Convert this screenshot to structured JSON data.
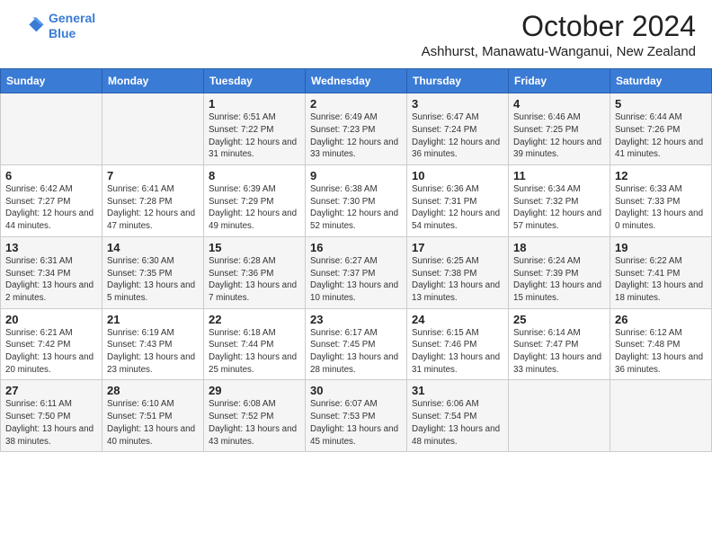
{
  "header": {
    "logo_line1": "General",
    "logo_line2": "Blue",
    "title": "October 2024",
    "subtitle": "Ashhurst, Manawatu-Wanganui, New Zealand"
  },
  "weekdays": [
    "Sunday",
    "Monday",
    "Tuesday",
    "Wednesday",
    "Thursday",
    "Friday",
    "Saturday"
  ],
  "weeks": [
    [
      {
        "day": "",
        "info": ""
      },
      {
        "day": "",
        "info": ""
      },
      {
        "day": "1",
        "info": "Sunrise: 6:51 AM\nSunset: 7:22 PM\nDaylight: 12 hours and 31 minutes."
      },
      {
        "day": "2",
        "info": "Sunrise: 6:49 AM\nSunset: 7:23 PM\nDaylight: 12 hours and 33 minutes."
      },
      {
        "day": "3",
        "info": "Sunrise: 6:47 AM\nSunset: 7:24 PM\nDaylight: 12 hours and 36 minutes."
      },
      {
        "day": "4",
        "info": "Sunrise: 6:46 AM\nSunset: 7:25 PM\nDaylight: 12 hours and 39 minutes."
      },
      {
        "day": "5",
        "info": "Sunrise: 6:44 AM\nSunset: 7:26 PM\nDaylight: 12 hours and 41 minutes."
      }
    ],
    [
      {
        "day": "6",
        "info": "Sunrise: 6:42 AM\nSunset: 7:27 PM\nDaylight: 12 hours and 44 minutes."
      },
      {
        "day": "7",
        "info": "Sunrise: 6:41 AM\nSunset: 7:28 PM\nDaylight: 12 hours and 47 minutes."
      },
      {
        "day": "8",
        "info": "Sunrise: 6:39 AM\nSunset: 7:29 PM\nDaylight: 12 hours and 49 minutes."
      },
      {
        "day": "9",
        "info": "Sunrise: 6:38 AM\nSunset: 7:30 PM\nDaylight: 12 hours and 52 minutes."
      },
      {
        "day": "10",
        "info": "Sunrise: 6:36 AM\nSunset: 7:31 PM\nDaylight: 12 hours and 54 minutes."
      },
      {
        "day": "11",
        "info": "Sunrise: 6:34 AM\nSunset: 7:32 PM\nDaylight: 12 hours and 57 minutes."
      },
      {
        "day": "12",
        "info": "Sunrise: 6:33 AM\nSunset: 7:33 PM\nDaylight: 13 hours and 0 minutes."
      }
    ],
    [
      {
        "day": "13",
        "info": "Sunrise: 6:31 AM\nSunset: 7:34 PM\nDaylight: 13 hours and 2 minutes."
      },
      {
        "day": "14",
        "info": "Sunrise: 6:30 AM\nSunset: 7:35 PM\nDaylight: 13 hours and 5 minutes."
      },
      {
        "day": "15",
        "info": "Sunrise: 6:28 AM\nSunset: 7:36 PM\nDaylight: 13 hours and 7 minutes."
      },
      {
        "day": "16",
        "info": "Sunrise: 6:27 AM\nSunset: 7:37 PM\nDaylight: 13 hours and 10 minutes."
      },
      {
        "day": "17",
        "info": "Sunrise: 6:25 AM\nSunset: 7:38 PM\nDaylight: 13 hours and 13 minutes."
      },
      {
        "day": "18",
        "info": "Sunrise: 6:24 AM\nSunset: 7:39 PM\nDaylight: 13 hours and 15 minutes."
      },
      {
        "day": "19",
        "info": "Sunrise: 6:22 AM\nSunset: 7:41 PM\nDaylight: 13 hours and 18 minutes."
      }
    ],
    [
      {
        "day": "20",
        "info": "Sunrise: 6:21 AM\nSunset: 7:42 PM\nDaylight: 13 hours and 20 minutes."
      },
      {
        "day": "21",
        "info": "Sunrise: 6:19 AM\nSunset: 7:43 PM\nDaylight: 13 hours and 23 minutes."
      },
      {
        "day": "22",
        "info": "Sunrise: 6:18 AM\nSunset: 7:44 PM\nDaylight: 13 hours and 25 minutes."
      },
      {
        "day": "23",
        "info": "Sunrise: 6:17 AM\nSunset: 7:45 PM\nDaylight: 13 hours and 28 minutes."
      },
      {
        "day": "24",
        "info": "Sunrise: 6:15 AM\nSunset: 7:46 PM\nDaylight: 13 hours and 31 minutes."
      },
      {
        "day": "25",
        "info": "Sunrise: 6:14 AM\nSunset: 7:47 PM\nDaylight: 13 hours and 33 minutes."
      },
      {
        "day": "26",
        "info": "Sunrise: 6:12 AM\nSunset: 7:48 PM\nDaylight: 13 hours and 36 minutes."
      }
    ],
    [
      {
        "day": "27",
        "info": "Sunrise: 6:11 AM\nSunset: 7:50 PM\nDaylight: 13 hours and 38 minutes."
      },
      {
        "day": "28",
        "info": "Sunrise: 6:10 AM\nSunset: 7:51 PM\nDaylight: 13 hours and 40 minutes."
      },
      {
        "day": "29",
        "info": "Sunrise: 6:08 AM\nSunset: 7:52 PM\nDaylight: 13 hours and 43 minutes."
      },
      {
        "day": "30",
        "info": "Sunrise: 6:07 AM\nSunset: 7:53 PM\nDaylight: 13 hours and 45 minutes."
      },
      {
        "day": "31",
        "info": "Sunrise: 6:06 AM\nSunset: 7:54 PM\nDaylight: 13 hours and 48 minutes."
      },
      {
        "day": "",
        "info": ""
      },
      {
        "day": "",
        "info": ""
      }
    ]
  ]
}
